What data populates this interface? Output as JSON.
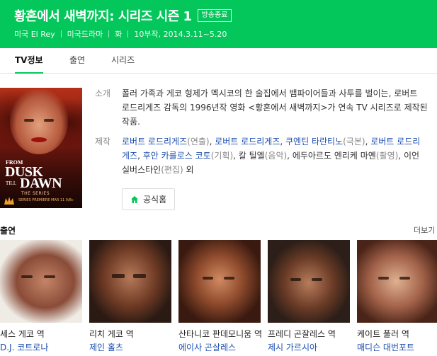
{
  "header": {
    "title": "황혼에서 새벽까지: 시리즈 시즌 1",
    "badge": "방송종료",
    "meta": [
      "미국 El Rey",
      "미국드라마",
      "화",
      "10부작, 2014.3.11~5.20"
    ],
    "bg_color": "#03c75a"
  },
  "tabs": [
    {
      "label": "TV정보",
      "active": true
    },
    {
      "label": "출연",
      "active": false
    },
    {
      "label": "시리즈",
      "active": false
    }
  ],
  "poster": {
    "from": "FROM",
    "dusk": "DUSK",
    "till": "TILL",
    "dawn": "DAWN",
    "series": "THE SERIES",
    "premiere": "SERIES PREMIERE MAR 11 9/8c",
    "logo": "EL REY"
  },
  "info": {
    "synopsis_label": "소개",
    "synopsis": "폴러 가족과 게코 형제가 멕시코의 한 술집에서 뱀파이어들과 사투를 벌이는, 로버트 로드리게즈 감독의 1996년작 영화 <황혼에서 새벽까지>가 연속 TV 시리즈로 제작된 작품.",
    "production_label": "제작",
    "production": [
      {
        "name": "로버트 로드리게즈",
        "role": "(연출)",
        "sep": ", "
      },
      {
        "name": "로버트 로드리게즈",
        "role": "",
        "sep": ", "
      },
      {
        "name": "쿠엔틴 타란티노",
        "role": "(극본)",
        "sep": ", "
      },
      {
        "name": "로버트 로드리게즈",
        "role": "",
        "sep": ", "
      },
      {
        "name": "후안 카를로스 코토",
        "role": "(기획)",
        "sep": ", "
      },
      {
        "name": "칼 틸엘",
        "role": "(음악)",
        "sep": ", "
      },
      {
        "name": "에두아르도 엔리케 마옌",
        "role": "(촬영)",
        "sep": ", "
      },
      {
        "name": "이언 실버스타인",
        "role": "(편집)",
        "sep": " 외"
      }
    ],
    "home_button": "공식홈"
  },
  "cast": {
    "title": "출연",
    "more": "더보기",
    "items": [
      {
        "role": "세스 게코 역",
        "actor": "D.J. 코트로나"
      },
      {
        "role": "리치 게코 역",
        "actor": "제인 홀츠"
      },
      {
        "role": "산타니코 판데모니움 역",
        "actor": "에이사 곤살레스"
      },
      {
        "role": "프레디 곤잘레스 역",
        "actor": "제시 가르시아"
      },
      {
        "role": "케이트 풀러 역",
        "actor": "매디슨 대번포트"
      }
    ]
  },
  "icons": {
    "home": "home-icon"
  }
}
